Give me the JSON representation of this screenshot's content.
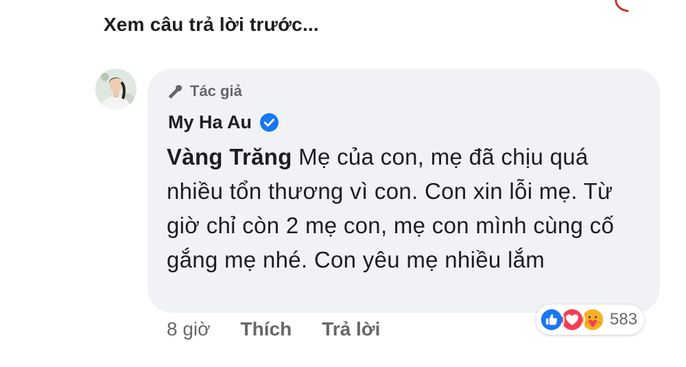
{
  "thread": {
    "see_previous_label": "Xem câu trả lời trước..."
  },
  "comment": {
    "author_badge_label": "Tác giả",
    "author_name": "My Ha Au",
    "mention": "Vàng Trăng",
    "text": " Mẹ của con, mẹ đã chịu quá nhiều tổn thương vì con. Con xin lỗi mẹ. Từ giờ chỉ còn 2 mẹ con, mẹ con mình cùng cố gắng mẹ nhé. Con yêu mẹ nhiều lắm",
    "time": "8 giờ",
    "like_label": "Thích",
    "reply_label": "Trả lời",
    "reaction_count": "583",
    "reactions": [
      "like-icon",
      "love-icon",
      "care-icon"
    ]
  },
  "colors": {
    "bubble_bg": "#f0f2f5",
    "verified_blue": "#1877f2",
    "secondary_text": "#65676b"
  }
}
